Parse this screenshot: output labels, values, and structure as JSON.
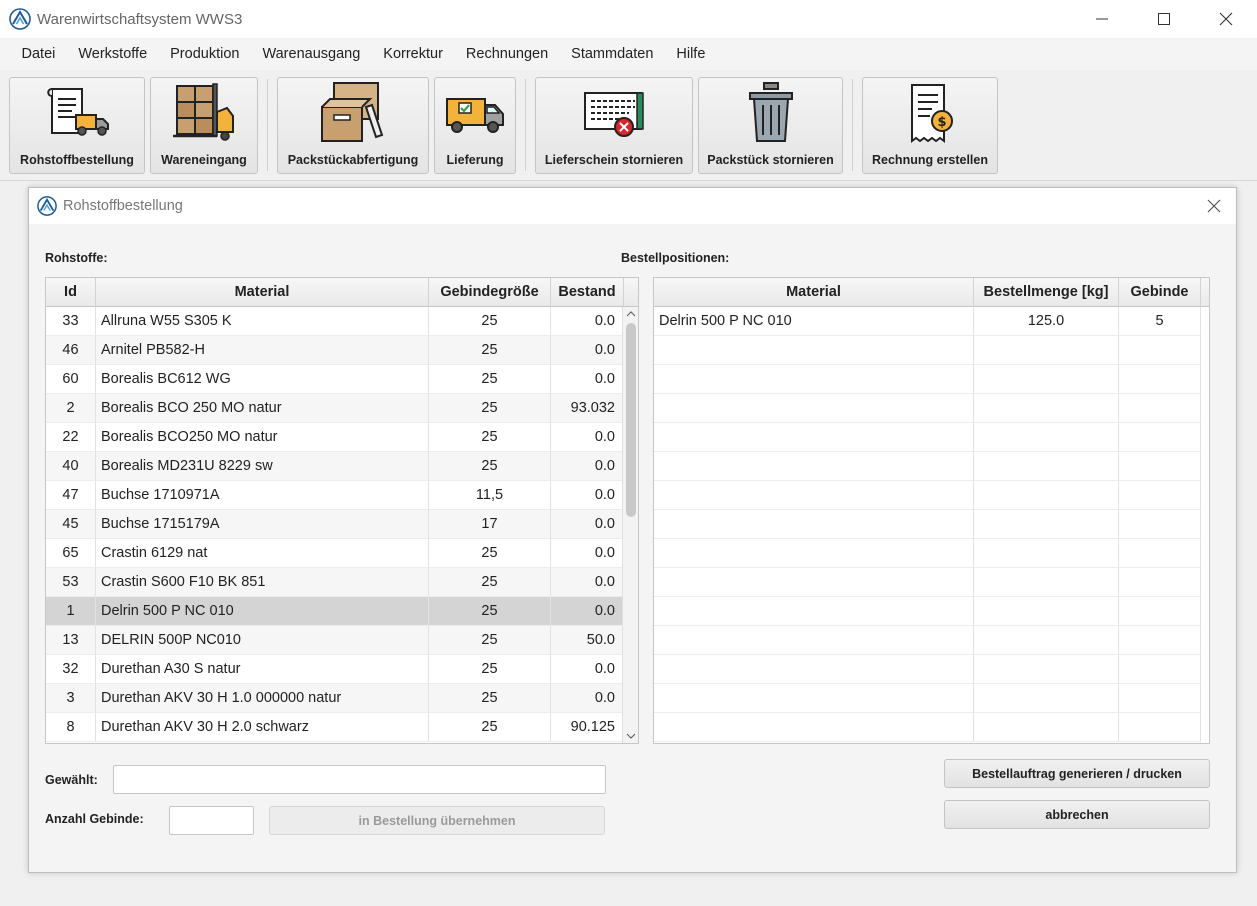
{
  "window": {
    "title": "Warenwirtschaftsystem WWS3"
  },
  "menu": [
    "Datei",
    "Werkstoffe",
    "Produktion",
    "Warenausgang",
    "Korrektur",
    "Rechnungen",
    "Stammdaten",
    "Hilfe"
  ],
  "toolbar": {
    "rohstoffbestellung": "Rohstoffbestellung",
    "wareneingang": "Wareneingang",
    "packstueckabfertigung": "Packstückabfertigung",
    "lieferung": "Lieferung",
    "lieferschein_stornieren": "Lieferschein stornieren",
    "packstueck_stornieren": "Packstück stornieren",
    "rechnung_erstellen": "Rechnung erstellen"
  },
  "dialog": {
    "title": "Rohstoffbestellung",
    "rohstoffe_label": "Rohstoffe:",
    "bestellpositionen_label": "Bestellpositionen:",
    "rohstoffe_table": {
      "columns": [
        "Id",
        "Material",
        "Gebindegröße",
        "Bestand"
      ],
      "selected_index": 10,
      "rows": [
        {
          "id": "33",
          "material": "Allruna W55 S305 K",
          "gebinde": "25",
          "bestand": "0.0"
        },
        {
          "id": "46",
          "material": "Arnitel PB582-H",
          "gebinde": "25",
          "bestand": "0.0"
        },
        {
          "id": "60",
          "material": "Borealis BC612 WG",
          "gebinde": "25",
          "bestand": "0.0"
        },
        {
          "id": "2",
          "material": "Borealis BCO 250 MO natur",
          "gebinde": "25",
          "bestand": "93.032"
        },
        {
          "id": "22",
          "material": "Borealis BCO250 MO natur",
          "gebinde": "25",
          "bestand": "0.0"
        },
        {
          "id": "40",
          "material": "Borealis MD231U 8229 sw",
          "gebinde": "25",
          "bestand": "0.0"
        },
        {
          "id": "47",
          "material": "Buchse 1710971A",
          "gebinde": "11,5",
          "bestand": "0.0"
        },
        {
          "id": "45",
          "material": "Buchse 1715179A",
          "gebinde": "17",
          "bestand": "0.0"
        },
        {
          "id": "65",
          "material": "Crastin 6129 nat",
          "gebinde": "25",
          "bestand": "0.0"
        },
        {
          "id": "53",
          "material": "Crastin S600 F10 BK 851",
          "gebinde": "25",
          "bestand": "0.0"
        },
        {
          "id": "1",
          "material": "Delrin 500 P NC 010",
          "gebinde": "25",
          "bestand": "0.0"
        },
        {
          "id": "13",
          "material": "DELRIN 500P NC010",
          "gebinde": "25",
          "bestand": "50.0"
        },
        {
          "id": "32",
          "material": "Durethan A30 S natur",
          "gebinde": "25",
          "bestand": "0.0"
        },
        {
          "id": "3",
          "material": "Durethan AKV 30 H 1.0 000000 natur",
          "gebinde": "25",
          "bestand": "0.0"
        },
        {
          "id": "8",
          "material": "Durethan AKV 30 H 2.0  schwarz",
          "gebinde": "25",
          "bestand": "90.125"
        }
      ]
    },
    "bestell_table": {
      "columns": [
        "Material",
        "Bestellmenge [kg]",
        "Gebinde"
      ],
      "rows": [
        {
          "material": "Delrin 500 P NC 010",
          "menge": "125.0",
          "gebinde": "5"
        }
      ],
      "empty_rows": 14
    },
    "gewaehlt_label": "Gewählt:",
    "gewaehlt_value": "",
    "anzahl_label": "Anzahl Gebinde:",
    "anzahl_value": "",
    "uebernehmen_button": "in Bestellung übernehmen",
    "generieren_button": "Bestellauftrag generieren  / drucken",
    "abbrechen_button": "abbrechen"
  }
}
